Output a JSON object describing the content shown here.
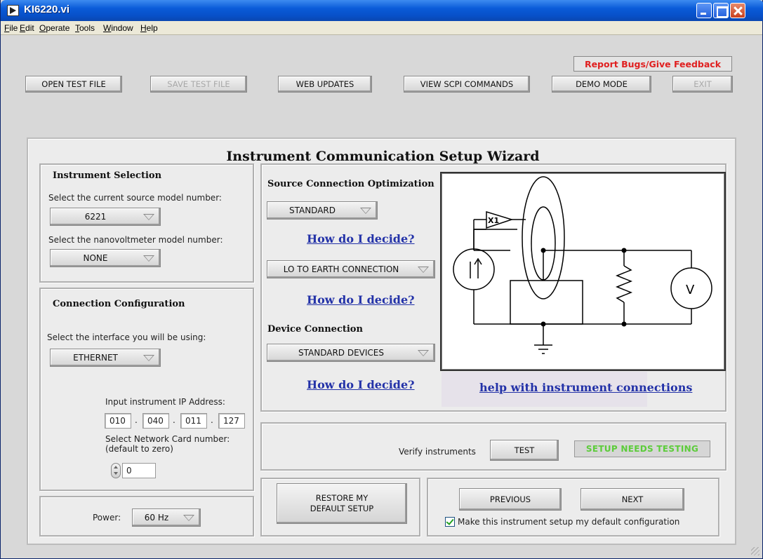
{
  "window": {
    "title": "KI6220.vi"
  },
  "menubar": [
    {
      "label": "File",
      "underline": "F"
    },
    {
      "label": "Edit",
      "underline": "E"
    },
    {
      "label": "Operate",
      "underline": "O"
    },
    {
      "label": "Tools",
      "underline": "T"
    },
    {
      "label": "Window",
      "underline": "W"
    },
    {
      "label": "Help",
      "underline": "H"
    }
  ],
  "toolbar": {
    "open_test_file": "OPEN TEST FILE",
    "save_test_file": "SAVE TEST FILE",
    "web_updates": "WEB UPDATES",
    "view_scpi": "VIEW SCPI COMMANDS",
    "demo_mode": "DEMO MODE",
    "exit": "EXIT",
    "report_bugs": "Report Bugs/Give Feedback"
  },
  "wizard": {
    "title": "Instrument Communication Setup Wizard",
    "instrument_selection": {
      "title": "Instrument Selection",
      "current_source_label": "Select the current source model number:",
      "current_source_value": "6221",
      "nanovoltmeter_label": "Select the nanovoltmeter model number:",
      "nanovoltmeter_value": "NONE"
    },
    "connection_configuration": {
      "title": "Connection Configuration",
      "interface_label": "Select the interface you will be using:",
      "interface_value": "ETHERNET",
      "ip_label": "Input instrument IP Address:",
      "ip_octets": [
        "010",
        "040",
        "011",
        "127"
      ],
      "netcard_label_1": "Select Network Card number:",
      "netcard_label_2": "(default to zero)",
      "netcard_value": "0"
    },
    "power": {
      "label": "Power:",
      "value": "60 Hz"
    },
    "source_connection": {
      "title": "Source Connection Optimization",
      "mode_value": "STANDARD",
      "earth_value": "LO TO EARTH CONNECTION",
      "how_decide": "How do I decide?"
    },
    "device_connection": {
      "title": "Device Connection",
      "value": "STANDARD DEVICES",
      "how_decide": "How do I decide?"
    },
    "diagram": {
      "buffer_label": "X1",
      "voltmeter_label": "V",
      "help_link": "help with instrument connections"
    },
    "verify": {
      "label": "Verify instruments",
      "test_button": "TEST",
      "status": "SETUP NEEDS TESTING",
      "status_color": "#5ccc3a"
    },
    "restore": {
      "line1": "RESTORE MY",
      "line2": "DEFAULT SETUP"
    },
    "nav": {
      "previous": "PREVIOUS",
      "next": "NEXT",
      "default_checkbox_label": "Make this instrument setup my default configuration",
      "default_checked": true
    }
  },
  "colors": {
    "link": "#2332a8",
    "report_bugs_text": "#e02020",
    "titlebar": "#0a5bd8"
  }
}
